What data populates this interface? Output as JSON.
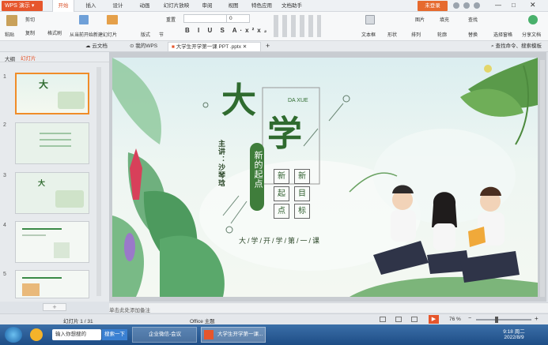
{
  "app": {
    "name": "WPS 演示"
  },
  "menu": [
    "开始",
    "插入",
    "设计",
    "动画",
    "幻灯片放映",
    "审阅",
    "视图",
    "特色应用",
    "文档助手"
  ],
  "menu_active": "开始",
  "login_label": "未登录",
  "ribbon": {
    "paste": "粘贴",
    "cut": "剪切",
    "copy": "复制",
    "format_painter": "格式刷",
    "from_current": "从当前开始",
    "new_slide": "新建幻灯片",
    "layout": "版式",
    "section": "节",
    "reset": "重置",
    "font_size": "0",
    "textbox": "文本框",
    "shape": "形状",
    "arrange": "排列",
    "outline": "轮廓",
    "picture": "图片",
    "fill": "填充",
    "find": "查找",
    "replace": "替换",
    "select_pane": "选择窗格",
    "share": "分享文档"
  },
  "tabs": {
    "cloud": "云文档",
    "mywps": "我的WPS",
    "doc": "大学生开学第一课 PPT .pptx",
    "search_cmd": "查找命令、搜索模板"
  },
  "panel": {
    "outline_tab": "大纲",
    "slides_tab": "幻灯片",
    "slide_numbers": [
      "1",
      "2",
      "3",
      "4",
      "5"
    ]
  },
  "slide": {
    "big1": "大",
    "big2": "学",
    "pinyin": "DA XUE",
    "speaker": "主讲：沙琴琀",
    "pill": "新的起点",
    "grid": [
      "新",
      "新",
      "起",
      "目",
      "点",
      "标"
    ],
    "tagline": "大/学/开/学/第/一/课"
  },
  "notes_placeholder": "单击此处添加备注",
  "status": {
    "slide_count": "幻灯片 1 / 31",
    "theme": "Office 主题",
    "zoom": "76 %"
  },
  "taskbar": {
    "search_placeholder": "输入你想搜的",
    "search_btn": "搜索一下",
    "task1": "企业微信-会议",
    "task2": "大学生开学第一课...",
    "time": "9:18 周二",
    "date": "2022/8/9"
  },
  "colors": {
    "accent": "#e6562c",
    "title_green": "#2f6b2f",
    "pill_green": "#3f7d3b"
  }
}
